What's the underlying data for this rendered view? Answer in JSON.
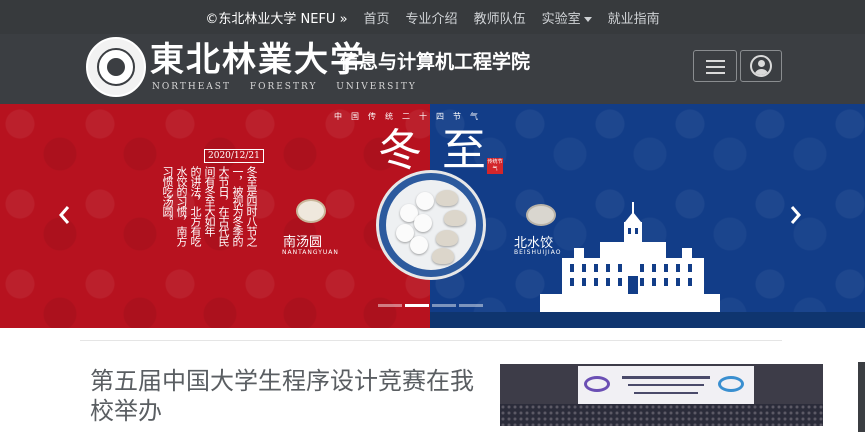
{
  "topnav": {
    "brand": "©东北林业大学 NEFU »",
    "items": [
      {
        "label": "首页"
      },
      {
        "label": "专业介绍"
      },
      {
        "label": "教师队伍"
      },
      {
        "label": "实验室",
        "dropdown": true
      },
      {
        "label": "就业指南"
      }
    ]
  },
  "header": {
    "university_name": "東北林業大学",
    "college_name": "信息与计算机工程学院",
    "university_en": "NORTHEAST FORESTRY UNIVERSITY",
    "menu_icon": "hamburger-menu-icon",
    "user_icon": "user-account-icon"
  },
  "banner": {
    "subtitle": "中国传统二十四节气",
    "headline": "冬至",
    "stamp": "传统节气",
    "date": "2020/12/21",
    "poem_columns": [
      "冬至是四时八节之",
      "一，被视为冬季的",
      "大节日，在古代民",
      "间有冬至大如年",
      "的讲法，北方有吃",
      "水饺的习惯，南方",
      "习惯吃汤圆。"
    ],
    "left_dish": "南汤圆",
    "left_dish_en": "NANTANGYUAN",
    "right_dish": "北水饺",
    "right_dish_en": "BEISHUIJIAO",
    "prev_icon": "chevron-left-icon",
    "next_icon": "chevron-right-icon",
    "slide_count": 4,
    "active_slide": 1,
    "colors": {
      "red": "#b7121f",
      "blue": "#123d88"
    }
  },
  "news": {
    "title": "第五届中国大学生程序设计竞赛在我校举办"
  },
  "colors": {
    "navbar": "#373a3d",
    "header": "#3b3e42"
  }
}
